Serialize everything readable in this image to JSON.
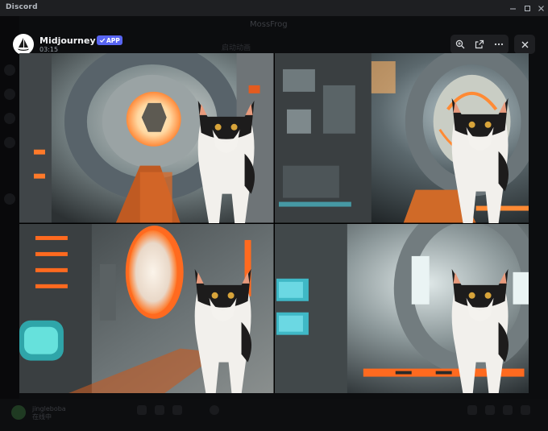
{
  "window": {
    "app_title": "Discord"
  },
  "background": {
    "channel_title": "MossFrog",
    "subtitle": "启动动画",
    "username": "jingleboba",
    "user_status": "在线中"
  },
  "message": {
    "bot_name": "Midjourney Bot",
    "badge": "APP",
    "timestamp": "03:15"
  },
  "viewer": {
    "image_count": 4,
    "tiles": [
      {
        "theme": "porthole-corridor",
        "accent": "#ff7a2a"
      },
      {
        "theme": "control-room",
        "accent": "#ff8a34"
      },
      {
        "theme": "airlock-door",
        "accent": "#ff6a1f"
      },
      {
        "theme": "cyan-corridor",
        "accent": "#4fd6e6"
      }
    ]
  },
  "colors": {
    "badge": "#5865f2",
    "overlay": "#0b0c0e",
    "toolbar": "#1e1f22"
  }
}
